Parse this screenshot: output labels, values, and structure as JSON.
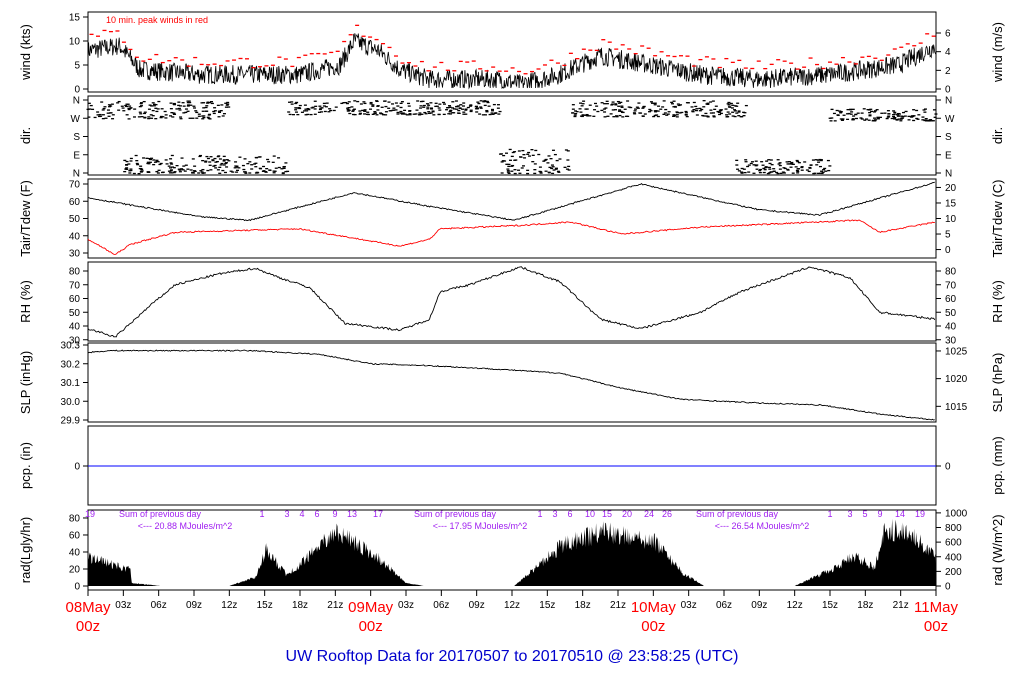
{
  "title": "UW Rooftop Data for 20170507  to  20170510 @ 23:58:25  (UTC)",
  "colors": {
    "line": "#000000",
    "peak": "#ff0000",
    "dewpoint": "#ff0000",
    "precip": "#0000ff",
    "rad_labels": "#a020f0",
    "title": "#0000cc",
    "date": "#ff0000"
  },
  "chart_data": {
    "type": "line",
    "x_range_hours": [
      0,
      72
    ],
    "x_ticks": [
      "03z",
      "06z",
      "09z",
      "12z",
      "15z",
      "18z",
      "21z",
      "03z",
      "06z",
      "09z",
      "12z",
      "15z",
      "18z",
      "21z",
      "03z",
      "06z",
      "09z",
      "12z",
      "15z",
      "18z",
      "21z"
    ],
    "date_labels": [
      {
        "day": "08May",
        "hour": "00z"
      },
      {
        "day": "09May",
        "hour": "00z"
      },
      {
        "day": "10May",
        "hour": "00z"
      },
      {
        "day": "11May",
        "hour": "00z"
      }
    ],
    "panels": [
      {
        "name": "wind",
        "ylabel": "wind (kts)",
        "ylabel_right": "wind (m/s)",
        "ylim": [
          0,
          15
        ],
        "yticks": [
          "0",
          "5",
          "10",
          "15"
        ],
        "yticks_right": [
          "0",
          "2",
          "4",
          "6"
        ],
        "annotation": "10 min. peak winds in red",
        "series": [
          {
            "name": "wind",
            "x": [
              0,
              2.7,
              4.4,
              9.5,
              18,
              21.4,
              22.6,
              24.7,
              26.5,
              29,
              35,
              36.7,
              40,
              43.5,
              47.8,
              52,
              57,
              63,
              68.8,
              72
            ],
            "y": [
              8,
              9,
              4,
              3,
              3,
              5,
              10,
              8,
              4,
              2,
              2,
              1,
              3,
              7,
              5,
              3,
              2,
              3,
              5,
              9
            ]
          }
        ]
      },
      {
        "name": "direction",
        "ylabel": "dir.",
        "ylabel_right": "dir.",
        "yticks": [
          "N",
          "E",
          "S",
          "W",
          "N"
        ],
        "segments_deg": [
          {
            "from_h": 0,
            "to_h": 12,
            "range": [
              270,
              360
            ]
          },
          {
            "from_h": 3,
            "to_h": 17,
            "range": [
              0,
              90
            ]
          },
          {
            "from_h": 17,
            "to_h": 35,
            "range": [
              290,
              360
            ]
          },
          {
            "from_h": 35,
            "to_h": 41,
            "range": [
              0,
              120
            ]
          },
          {
            "from_h": 41,
            "to_h": 56,
            "range": [
              280,
              360
            ]
          },
          {
            "from_h": 55,
            "to_h": 63,
            "range": [
              0,
              70
            ]
          },
          {
            "from_h": 63,
            "to_h": 72,
            "range": [
              260,
              320
            ]
          }
        ]
      },
      {
        "name": "temperature",
        "ylabel": "Tair/Tdew (F)",
        "ylabel_right": "Tair/Tdew (C)",
        "ylim": [
          27,
          72
        ],
        "yticks": [
          "30",
          "40",
          "50",
          "60",
          "70"
        ],
        "yticks_right": [
          "0",
          "5",
          "10",
          "15",
          "20"
        ],
        "series": [
          {
            "name": "Tair",
            "x": [
              0,
              9.5,
              13.7,
              22.6,
              29,
              36.2,
              46.9,
              57,
              62.1,
              72
            ],
            "y": [
              62,
              51,
              49,
              65,
              57,
              49,
              70,
              55,
              52,
              71
            ]
          },
          {
            "name": "Tdew",
            "x": [
              0,
              2.3,
              3.6,
              7.4,
              17.9,
              21.4,
              26.5,
              29,
              29.9,
              36.7,
              41,
              45.3,
              52,
              65.5,
              67.2,
              72
            ],
            "y": [
              38,
              29,
              35,
              42,
              44,
              40,
              34,
              38,
              44,
              46,
              48,
              41,
              45,
              49,
              42,
              48
            ]
          }
        ]
      },
      {
        "name": "rh",
        "ylabel": "RH (%)",
        "ylabel_right": "RH (%)",
        "ylim": [
          30,
          85
        ],
        "yticks": [
          "30",
          "40",
          "50",
          "60",
          "70",
          "80"
        ],
        "series": [
          {
            "name": "RH",
            "x": [
              0,
              2.3,
              3.1,
              5.3,
              7.4,
              11.2,
              14.2,
              16.3,
              18.8,
              21.8,
              26.5,
              29,
              29.9,
              32.4,
              36.7,
              40.1,
              43.5,
              46.9,
              52,
              55.4,
              61.3,
              64.7,
              67.2,
              72
            ],
            "y": [
              38,
              32,
              38,
              55,
              70,
              78,
              82,
              75,
              68,
              42,
              37,
              45,
              65,
              70,
              83,
              72,
              45,
              38,
              50,
              65,
              83,
              75,
              50,
              45
            ]
          }
        ]
      },
      {
        "name": "pressure",
        "ylabel": "SLP (inHg)",
        "ylabel_right": "SLP (hPa)",
        "ylim": [
          29.89,
          30.3
        ],
        "yticks": [
          "29.9",
          "30.0",
          "30.1",
          "30.2",
          "30.3"
        ],
        "yticks_right": [
          "1015",
          "1020",
          "1025"
        ],
        "series": [
          {
            "name": "SLP",
            "x": [
              0,
              1.9,
              5.3,
              13.8,
              19.7,
              24,
              29,
              35,
              40.1,
              45.3,
              50.4,
              57.2,
              62.3,
              67.4,
              72
            ],
            "y": [
              30.26,
              30.27,
              30.27,
              30.27,
              30.25,
              30.2,
              30.19,
              30.17,
              30.15,
              30.07,
              30.01,
              29.99,
              29.98,
              29.93,
              29.9
            ]
          }
        ]
      },
      {
        "name": "precip",
        "ylabel": "pcp. (in)",
        "ylabel_right": "pcp. (mm)",
        "yticks": [
          "0"
        ],
        "yticks_right": [
          "0"
        ],
        "series": [
          {
            "name": "pcp",
            "y": [
              0
            ]
          }
        ]
      },
      {
        "name": "radiation",
        "ylabel": "rad(Lgly/hr)",
        "ylabel_right": "rad (W/m^2)",
        "ylim": [
          0,
          1000
        ],
        "yticks": [
          "0",
          "20",
          "40",
          "60",
          "80"
        ],
        "yticks_right": [
          "0",
          "200",
          "400",
          "600",
          "800",
          "1000"
        ],
        "series": [
          {
            "name": "rad",
            "x": [
              0,
              3.6,
              3.7,
              6.1,
              12,
              14.3,
              15.1,
              16.8,
              17.7,
              21,
              24.4,
              27,
              28.5,
              36.2,
              40.4,
              43.8,
              48,
              50.6,
              52.3,
              60,
              63.4,
              65.1,
              66.8,
              67.6,
              70.2,
              72
            ],
            "y": [
              480,
              270,
              50,
              0,
              0,
              150,
              600,
              200,
              300,
              900,
              500,
              50,
              0,
              0,
              700,
              900,
              750,
              200,
              0,
              0,
              300,
              500,
              300,
              950,
              850,
              450
            ]
          }
        ],
        "daily_totals": [
          {
            "label": "Sum of previous day",
            "value": "<--- 20.88 MJoules/m^2"
          },
          {
            "label": "Sum of previous day",
            "value": "<--- 17.95 MJoules/m^2"
          },
          {
            "label": "Sum of previous day",
            "value": "<--- 26.54 MJoules/m^2"
          }
        ],
        "hour_markers": [
          [
            "19"
          ],
          [
            "1",
            "3",
            "4",
            "6",
            "9",
            "13",
            "17"
          ],
          [
            "1",
            "3",
            "6",
            "10",
            "15",
            "20",
            "24",
            "26"
          ],
          [
            "1",
            "3",
            "5",
            "9",
            "14",
            "19"
          ]
        ]
      }
    ]
  }
}
